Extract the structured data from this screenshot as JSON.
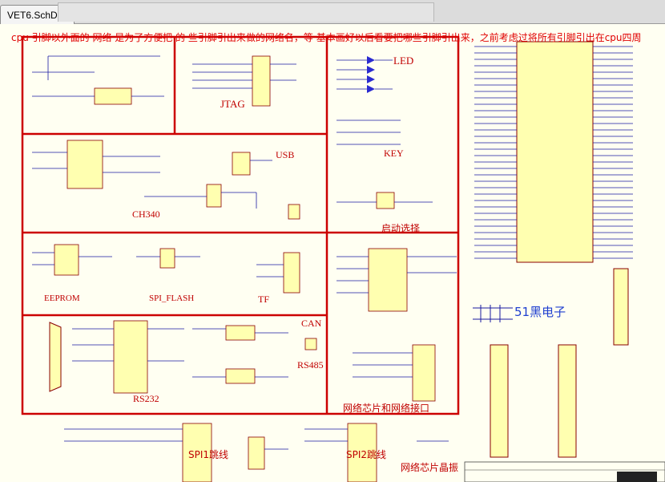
{
  "app": {
    "tab_label": "VET6.SchDoc"
  },
  "header_comment": "cpu 引脚以外面的 网络 是为了方便把 的 些引脚引出来做的网络名，等 基本画好以后看要把哪些引脚引出来，之前考虑过将所有引脚引出在cpu四周",
  "blocks": {
    "jtag": "JTAG",
    "led": "LED",
    "key": "KEY",
    "usb": "USB",
    "ch340": "CH340",
    "boot": "启动选择",
    "eeprom": "EEPROM",
    "spi_flash": "SPI_FLASH",
    "tf": "TF",
    "can": "CAN",
    "rs485": "RS485",
    "rs232": "RS232",
    "net_chip": "网络芯片和网络接口",
    "spi1": "SPI1跳线",
    "spi2": "SPI2跳线",
    "net_crystal": "网络芯片晶振"
  },
  "watermark": "51黑电子",
  "colors": {
    "sheet_bg": "#fffff2",
    "box_red": "#cc0000",
    "wire_blue": "#1a1aa0",
    "part_fill": "#ffffb0",
    "part_border": "#8a0000"
  }
}
